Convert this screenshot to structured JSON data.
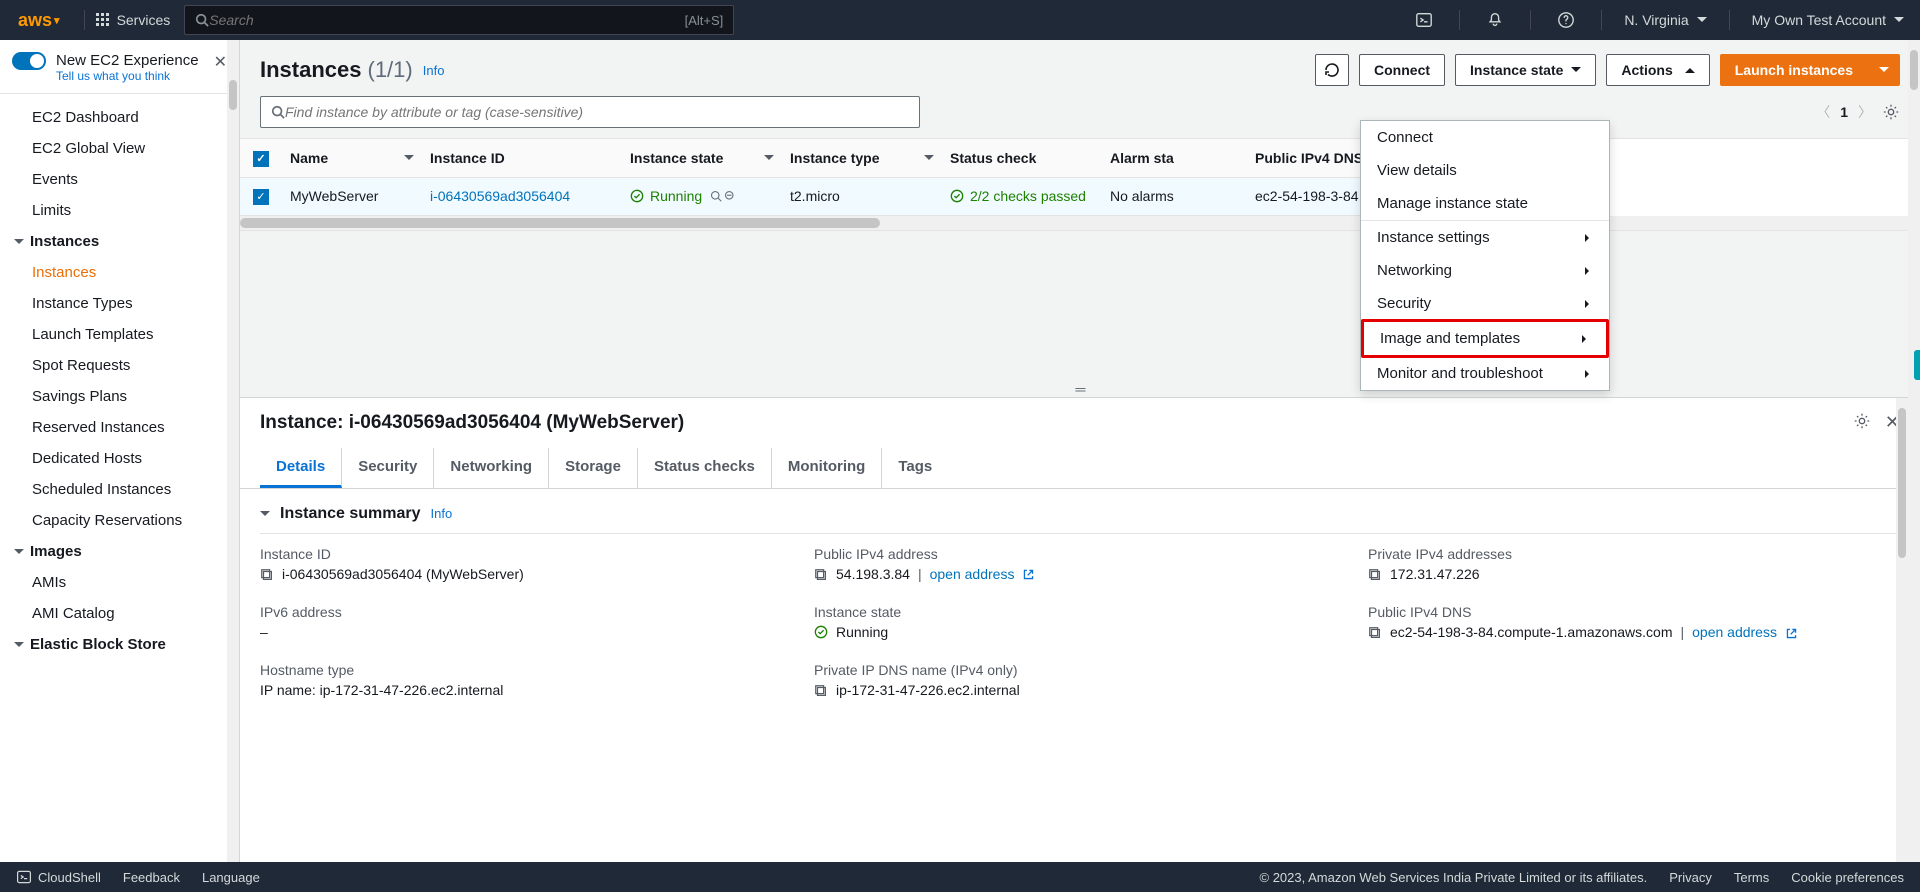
{
  "topnav": {
    "logo": "aws",
    "services": "Services",
    "search_placeholder": "Search",
    "kbd": "[Alt+S]",
    "region": "N. Virginia",
    "account": "My Own Test Account"
  },
  "sidebar": {
    "experience": {
      "title": "New EC2 Experience",
      "sub": "Tell us what you think"
    },
    "top_items": [
      "EC2 Dashboard",
      "EC2 Global View",
      "Events",
      "Limits"
    ],
    "sections": [
      {
        "title": "Instances",
        "items": [
          "Instances",
          "Instance Types",
          "Launch Templates",
          "Spot Requests",
          "Savings Plans",
          "Reserved Instances",
          "Dedicated Hosts",
          "Scheduled Instances",
          "Capacity Reservations"
        ],
        "active_index": 0
      },
      {
        "title": "Images",
        "items": [
          "AMIs",
          "AMI Catalog"
        ]
      },
      {
        "title": "Elastic Block Store",
        "items": []
      }
    ]
  },
  "header": {
    "title": "Instances",
    "count": "(1/1)",
    "info": "Info",
    "buttons": {
      "connect": "Connect",
      "instance_state": "Instance state",
      "actions": "Actions",
      "launch": "Launch instances"
    }
  },
  "filter_placeholder": "Find instance by attribute or tag (case-sensitive)",
  "pager": {
    "page": "1"
  },
  "table": {
    "cols": [
      "Name",
      "Instance ID",
      "Instance state",
      "Instance type",
      "Status check",
      "Alarm status",
      "Public IPv4 DNS"
    ],
    "row": {
      "name": "MyWebServer",
      "id": "i-06430569ad3056404",
      "state": "Running",
      "type": "t2.micro",
      "status": "2/2 checks passed",
      "alarm": "No alarms",
      "dns": "ec2-54-198-3-84"
    }
  },
  "actions_menu": [
    "Connect",
    "View details",
    "Manage instance state",
    "Instance settings",
    "Networking",
    "Security",
    "Image and templates",
    "Monitor and troubleshoot"
  ],
  "detail": {
    "title_prefix": "Instance: ",
    "title": "i-06430569ad3056404 (MyWebServer)",
    "tabs": [
      "Details",
      "Security",
      "Networking",
      "Storage",
      "Status checks",
      "Monitoring",
      "Tags"
    ],
    "active_tab": 0,
    "summary_title": "Instance summary",
    "info": "Info",
    "fields": {
      "instance_id_l": "Instance ID",
      "instance_id_v": "i-06430569ad3056404 (MyWebServer)",
      "pub_ip_l": "Public IPv4 address",
      "pub_ip_v": "54.198.3.84",
      "open_addr": "open address",
      "priv_ip_l": "Private IPv4 addresses",
      "priv_ip_v": "172.31.47.226",
      "ipv6_l": "IPv6 address",
      "ipv6_v": "–",
      "state_l": "Instance state",
      "state_v": "Running",
      "dns_l": "Public IPv4 DNS",
      "dns_v": "ec2-54-198-3-84.compute-1.amazonaws.com",
      "hostname_l": "Hostname type",
      "hostname_v": "IP name: ip-172-31-47-226.ec2.internal",
      "privdns_l": "Private IP DNS name (IPv4 only)",
      "privdns_v": "ip-172-31-47-226.ec2.internal"
    }
  },
  "footer": {
    "cloudshell": "CloudShell",
    "feedback": "Feedback",
    "language": "Language",
    "copyright": "© 2023, Amazon Web Services India Private Limited or its affiliates.",
    "links": [
      "Privacy",
      "Terms",
      "Cookie preferences"
    ]
  }
}
